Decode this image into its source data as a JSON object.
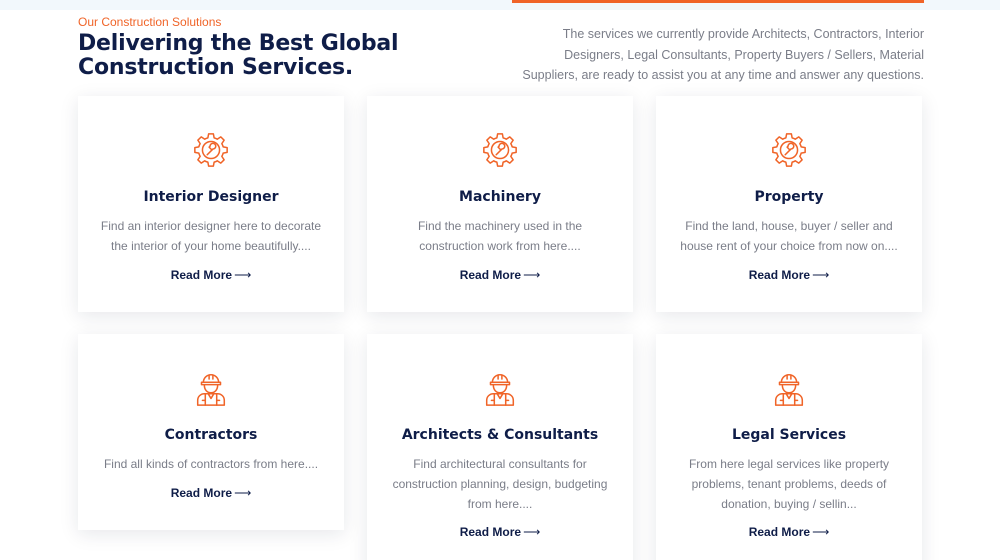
{
  "colors": {
    "accent": "#f06428",
    "heading": "#0f1d48",
    "body_text": "#7a7d88"
  },
  "header": {
    "eyebrow": "Our Construction Solutions",
    "title_line1": "Delivering the Best Global",
    "title_line2": "Construction Services.",
    "intro": "The services we currently provide Architects, Contractors, Interior Designers, Legal Consultants, Property Buyers / Sellers, Material Suppliers, are ready to assist you at any time and answer any questions."
  },
  "cards": [
    {
      "icon": "gear-wrench-icon",
      "title": "Interior Designer",
      "description": "Find an interior designer here to decorate the interior of your home beautifully....",
      "link": "Read More"
    },
    {
      "icon": "gear-wrench-icon",
      "title": "Machinery",
      "description": "Find the machinery used in the construction work from here....",
      "link": "Read More"
    },
    {
      "icon": "gear-wrench-icon",
      "title": "Property",
      "description": "Find the land, house, buyer / seller and house rent of your choice from now on....",
      "link": "Read More"
    },
    {
      "icon": "construction-worker-icon",
      "title": "Contractors",
      "description": "Find all kinds of contractors from here....",
      "link": "Read More"
    },
    {
      "icon": "construction-worker-icon",
      "title": "Architects & Consultants",
      "description": "Find architectural consultants for construction planning, design, budgeting from here....",
      "link": "Read More"
    },
    {
      "icon": "construction-worker-icon",
      "title": "Legal Services",
      "description": "From here legal services like property problems, tenant problems, deeds of donation, buying / sellin...",
      "link": "Read More"
    }
  ]
}
